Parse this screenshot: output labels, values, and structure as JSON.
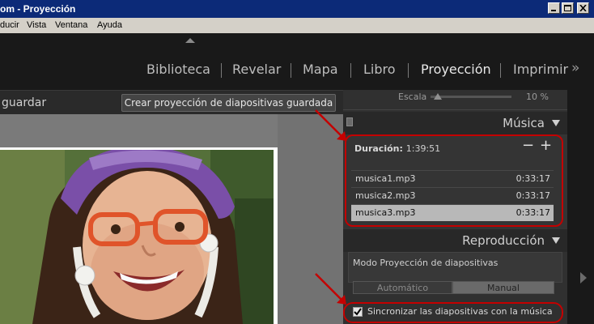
{
  "window": {
    "title": "om - Proyección",
    "buttons": [
      "minimize",
      "maximize",
      "close"
    ]
  },
  "menu": {
    "items": [
      "ducir",
      "Vista",
      "Ventana",
      "Ayuda"
    ]
  },
  "modules": {
    "items": [
      {
        "label": "Biblioteca",
        "active": false
      },
      {
        "label": "Revelar",
        "active": false
      },
      {
        "label": "Mapa",
        "active": false
      },
      {
        "label": "Libro",
        "active": false
      },
      {
        "label": "Proyección",
        "active": true
      },
      {
        "label": "Imprimir",
        "active": false
      }
    ],
    "overflow_icon": "»"
  },
  "toolbar": {
    "save_label": "guardar",
    "create_button": "Crear proyección de diapositivas guardada"
  },
  "panel": {
    "scale": {
      "label": "Escala",
      "value": "10 %",
      "level_fraction": 0.06
    },
    "music": {
      "title": "Música",
      "duration_label": "Duración:",
      "duration_value": "1:39:51",
      "remove_icon": "−",
      "add_icon": "+",
      "tracks": [
        {
          "file": "musica1.mp3",
          "time": "0:33:17",
          "selected": false
        },
        {
          "file": "musica2.mp3",
          "time": "0:33:17",
          "selected": false
        },
        {
          "file": "musica3.mp3",
          "time": "0:33:17",
          "selected": true
        }
      ]
    },
    "playback": {
      "title": "Reproducción",
      "mode_label": "Modo Proyección de diapositivas",
      "auto_label": "Automático",
      "manual_label": "Manual",
      "sync_label": "Sincronizar las diapositivas con la música",
      "sync_checked": true
    }
  },
  "colors": {
    "annotation": "#c40000",
    "panel_bg": "#303030",
    "titlebar": "#0c2a78",
    "selected_row": "#b8b8b8"
  }
}
